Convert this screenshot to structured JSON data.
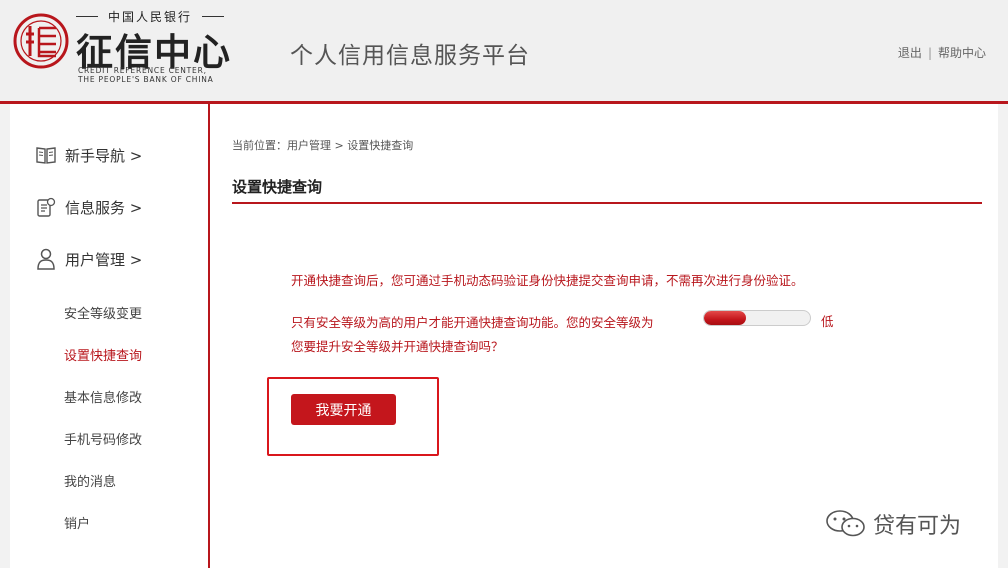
{
  "header": {
    "logo_top_text": "中国人民银行",
    "logo_cn": "征信中心",
    "logo_en_line1": "CREDIT REFERENCE CENTER,",
    "logo_en_line2": "THE PEOPLE'S BANK OF CHINA",
    "platform_title": "个人信用信息服务平台",
    "logout_label": "退出",
    "separator": "|",
    "help_label": "帮助中心"
  },
  "sidebar": {
    "main_items": [
      {
        "label": "新手导航 >",
        "icon": "book-icon"
      },
      {
        "label": "信息服务 >",
        "icon": "document-icon"
      },
      {
        "label": "用户管理 >",
        "icon": "user-icon"
      }
    ],
    "sub_items": [
      {
        "label": "安全等级变更"
      },
      {
        "label": "设置快捷查询",
        "active": true
      },
      {
        "label": "基本信息修改"
      },
      {
        "label": "手机号码修改"
      },
      {
        "label": "我的消息"
      },
      {
        "label": "销户"
      }
    ]
  },
  "content": {
    "breadcrumb": "当前位置：用户管理 > 设置快捷查询",
    "title": "设置快捷查询",
    "message1": "开通快捷查询后，您可通过手机动态码验证身份快捷提交查询申请，不需再次进行身份验证。",
    "message2": "只有安全等级为高的用户才能开通快捷查询功能。您的安全等级为",
    "security_level_text": "低",
    "security_level_fraction": 0.4,
    "message3": "您要提升安全等级并开通快捷查询吗？",
    "button_label": "我要开通"
  },
  "watermark": {
    "text": "贷有可为",
    "icon": "wechat-icon"
  },
  "colors": {
    "accent": "#b8161c",
    "button": "#c4161c"
  }
}
